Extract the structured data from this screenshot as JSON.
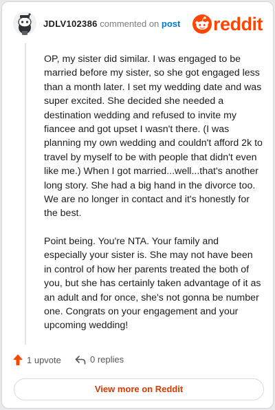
{
  "header": {
    "username": "JDLV102386",
    "action_text": "commented on",
    "post_link": "post",
    "logo_text": "reddit"
  },
  "comment": {
    "paragraphs": [
      "OP, my sister did similar. I was engaged to be married before my sister, so she got engaged less than a month later. I set my wedding date and was super excited. She decided she needed a destination wedding and refused to invite my fiancee and got upset I wasn't there. (I was planning my own wedding and couldn't afford 2k to travel by myself to be with people that didn't even like me.) When I got married...well...that's another long story. She had a big hand in the divorce too. We are no longer in contact and it's honestly for the best.",
      "Point being. You're NTA. Your family and especially your sister is. She may not have been in control of how her parents treated the both of you, but she has certainly taken advantage of it as an adult and for once, she's not gonna be number one. Congrats on your engagement and your upcoming wedding!"
    ]
  },
  "footer": {
    "upvotes": "1 upvote",
    "replies": "0 replies"
  },
  "view_more": "View more on Reddit",
  "colors": {
    "brand": "#ff4500",
    "link": "#0079d3",
    "view_more_text": "#d93a00"
  },
  "icons": {
    "avatar": "snoo-avatar",
    "logo": "reddit-snoo-icon",
    "upvote": "upvote-arrow-icon",
    "reply": "reply-arrow-icon"
  }
}
